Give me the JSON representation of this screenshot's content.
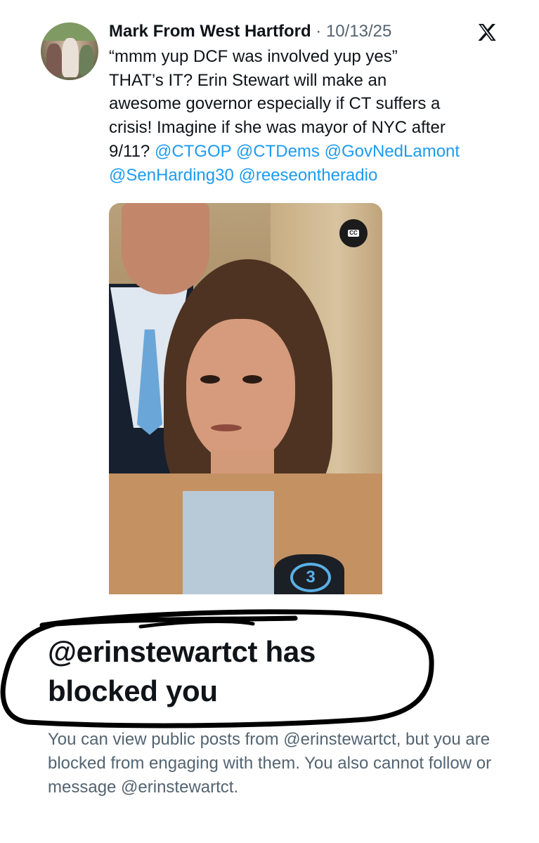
{
  "tweet": {
    "author_name": "Mark From West Hartford",
    "separator": "·",
    "date": "10/13/25",
    "text_lines": [
      "“mmm yup DCF was involved yup yes”",
      "THAT’s IT? Erin Stewart will make an",
      "awesome governor especially if CT suffers a",
      "crisis! Imagine if she was mayor of NYC after"
    ],
    "line5_prefix": "9/11? ",
    "mentions": [
      "@CTGOP",
      "@CTDems",
      "@GovNedLamont",
      "@SenHarding30",
      "@reeseontheradio"
    ],
    "media": {
      "cc_label": "CC",
      "mic_number": "3"
    },
    "colors": {
      "mention": "#1d9bf0",
      "secondary_text": "#536471"
    },
    "icons": {
      "x_logo": "x-logo-icon",
      "cc": "closed-captions-icon"
    }
  },
  "blocked_notice": {
    "title": "@erinstewartct has blocked you",
    "body": "You can view public posts from @erinstewartct, but you are blocked from engaging with them. You also cannot follow or message @erinstewartct."
  }
}
